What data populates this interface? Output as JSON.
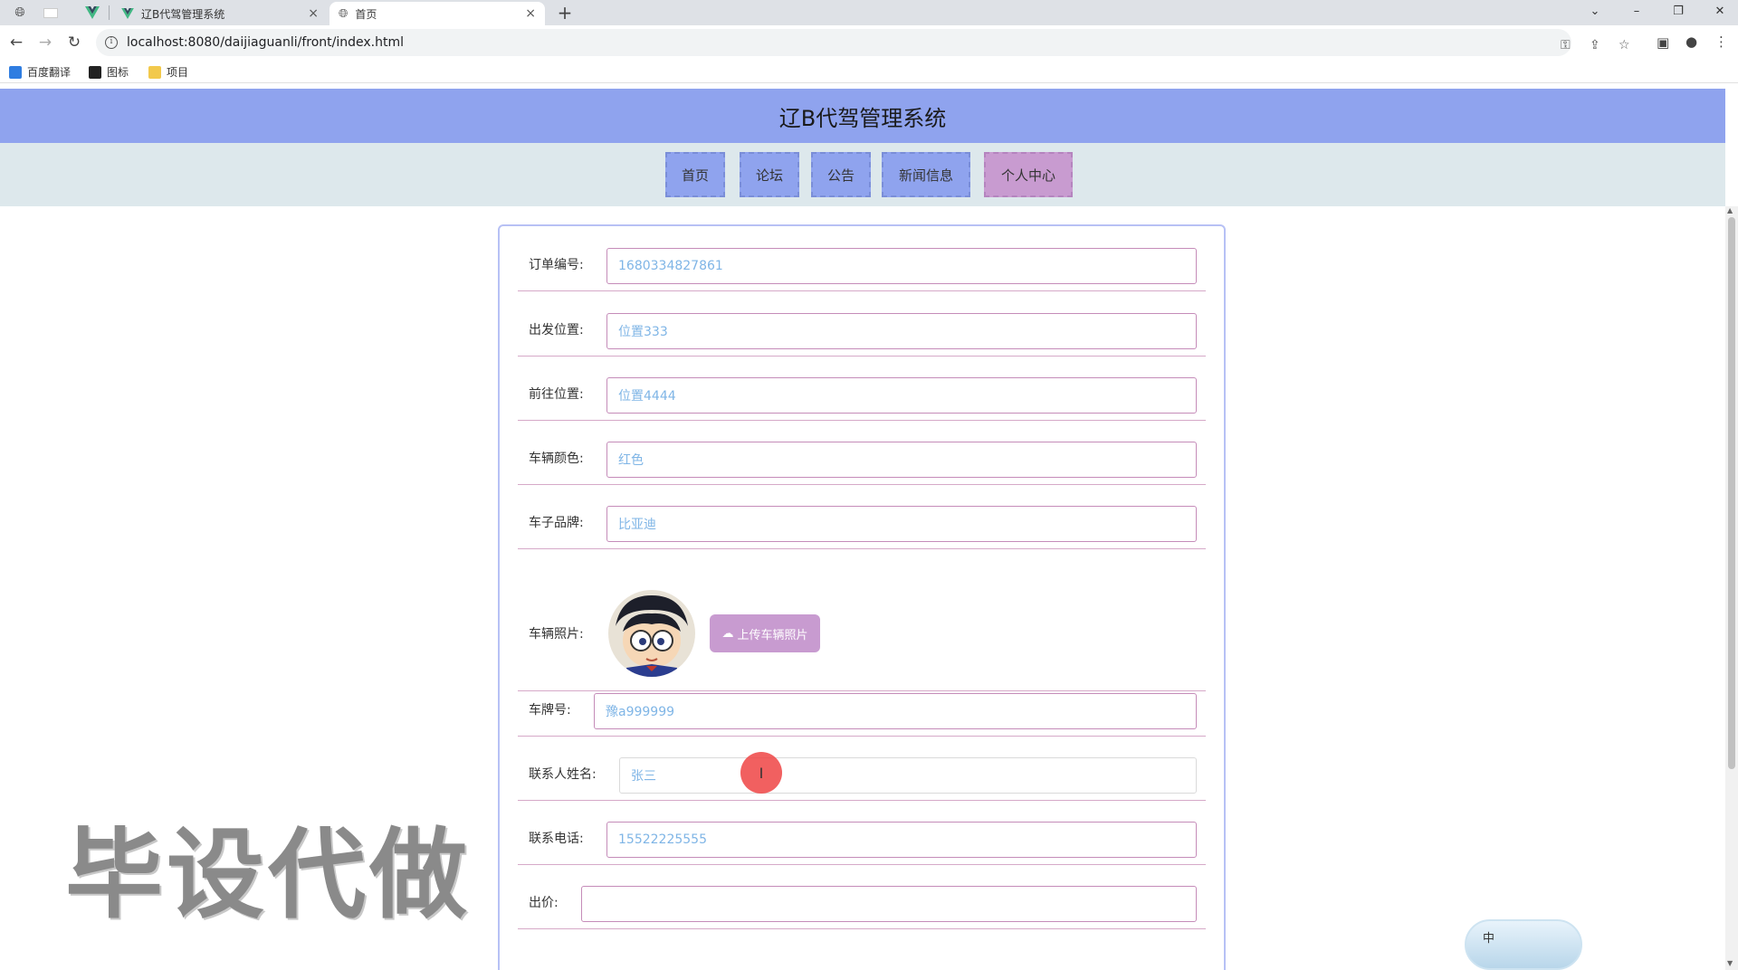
{
  "browser": {
    "tabs": [
      {
        "title": "辽B代驾管理系统",
        "close": "×"
      },
      {
        "title": "首页",
        "close": "×"
      }
    ],
    "new_tab": "+",
    "window_controls": {
      "chevron": "⌄",
      "minimize": "–",
      "restore": "❐",
      "close": "✕"
    },
    "url": "localhost:8080/daijiaguanli/front/index.html",
    "bookmarks": [
      {
        "label": "百度翻译",
        "color": "#2f7de1"
      },
      {
        "label": "图标",
        "color": "#222222"
      },
      {
        "label": "项目",
        "color": "#f2c94c"
      }
    ]
  },
  "site": {
    "title": "辽B代驾管理系统",
    "nav": [
      {
        "label": "首页",
        "active": false
      },
      {
        "label": "论坛",
        "active": false
      },
      {
        "label": "公告",
        "active": false
      },
      {
        "label": "新闻信息",
        "active": false
      },
      {
        "label": "个人中心",
        "active": true
      }
    ]
  },
  "form": {
    "fields": [
      {
        "label": "订单编号:",
        "value": "1680334827861"
      },
      {
        "label": "出发位置:",
        "value": "位置333"
      },
      {
        "label": "前往位置:",
        "value": "位置4444"
      },
      {
        "label": "车辆颜色:",
        "value": "红色"
      },
      {
        "label": "车子品牌:",
        "value": "比亚迪"
      }
    ],
    "photo": {
      "label": "车辆照片:",
      "upload_label": "上传车辆照片"
    },
    "fields2": [
      {
        "label": "车牌号:",
        "value": "豫a999999"
      },
      {
        "label": "联系人姓名:",
        "value": "张三"
      },
      {
        "label": "联系电话:",
        "value": "15522225555"
      },
      {
        "label": "出价:",
        "value": ""
      }
    ]
  },
  "watermark": "毕设代做",
  "ime": {
    "char": "中"
  },
  "colors": {
    "header": "#8fa3ee",
    "nav_strip": "#dde8ec",
    "nav_active": "#c89bd0",
    "input_border": "#c58cb9",
    "input_text": "#7fb5e6"
  }
}
